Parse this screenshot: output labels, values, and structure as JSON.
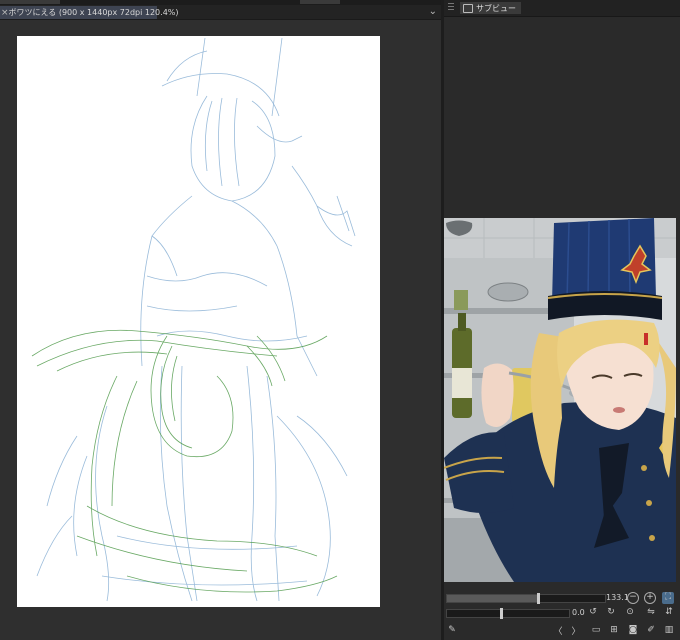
{
  "document_tab": {
    "close_glyph": "×",
    "title": "ボワツにえる (900 x 1440px 72dpi 120.4%)",
    "menu_glyph": "⌄"
  },
  "subview_panel": {
    "tab_label": "サブビュー"
  },
  "navigator": {
    "zoom_value": "133.1",
    "rotation_value": "0.0"
  },
  "icons": {
    "zoom_out": "−",
    "zoom_in": "+",
    "prev": "〈",
    "next": "〉"
  },
  "colors": {
    "panel_bg": "#2a2a2a",
    "tab_active": "#3e4452",
    "accent": "#4a6c8c",
    "sketch_blue": "#8fb4d6",
    "sketch_green": "#4f9a4a"
  }
}
